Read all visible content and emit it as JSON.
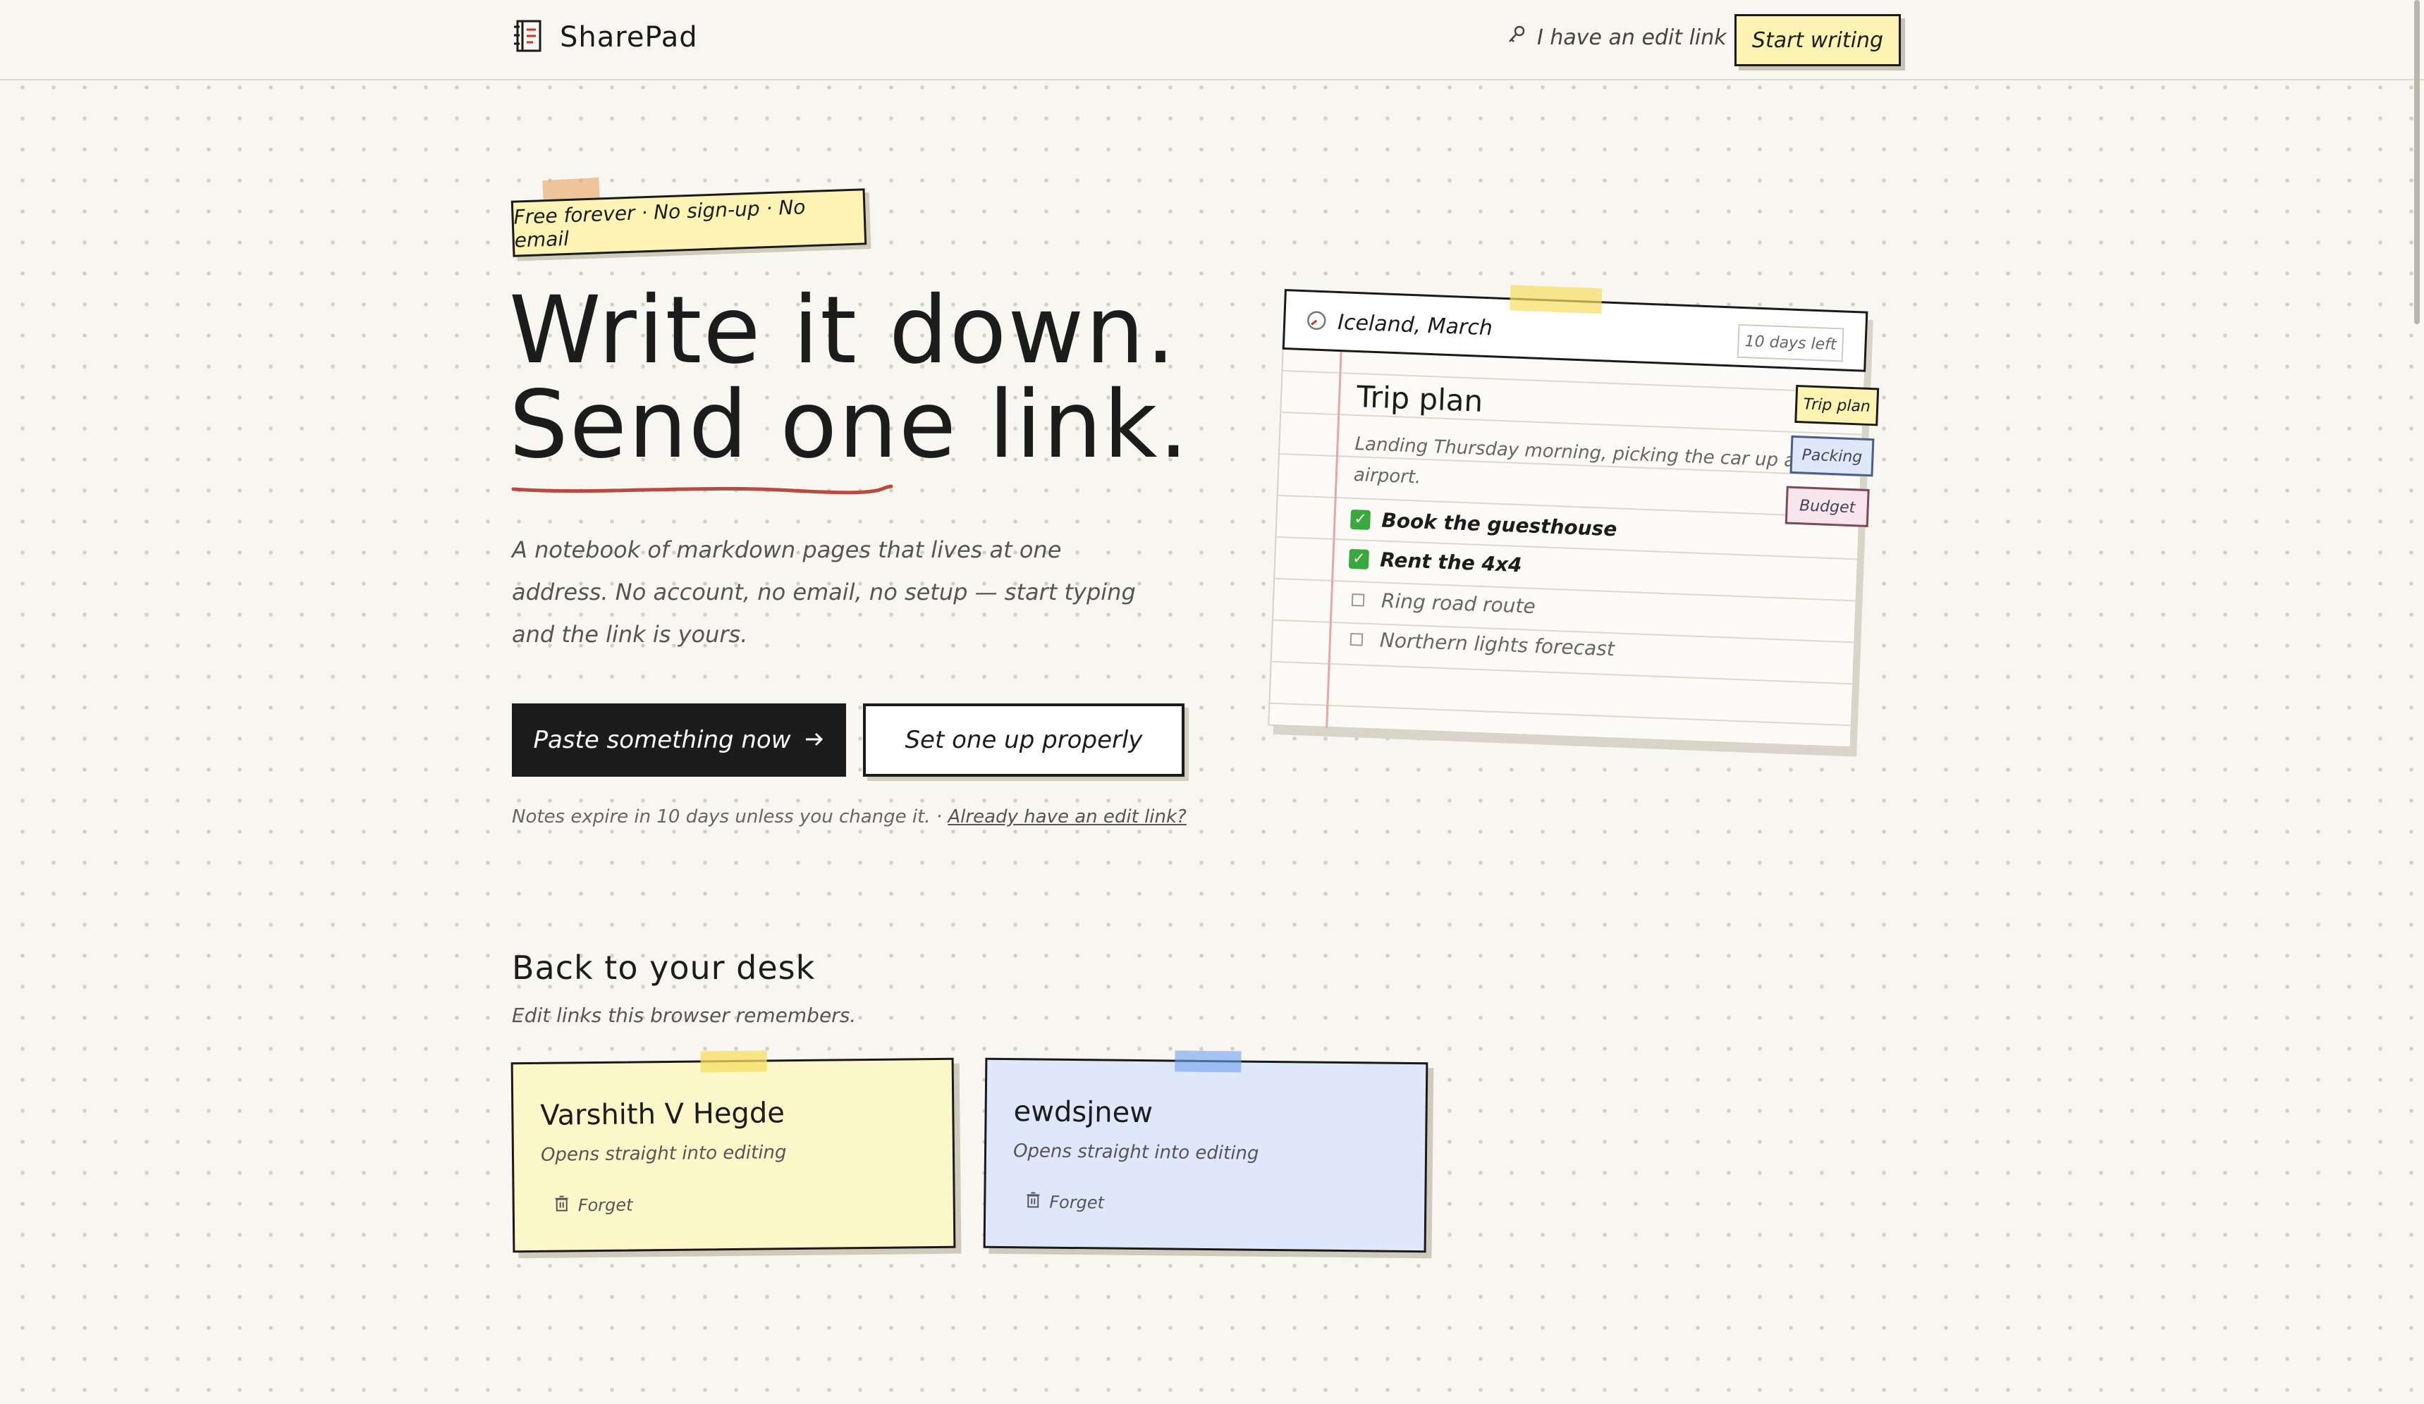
{
  "header": {
    "logo_name": "SharePad",
    "edit_link_label": "I have an edit link",
    "start_button_label": "Start writing"
  },
  "hero": {
    "badge": "Free forever · No sign-up · No email",
    "headline_line1": "Write it down.",
    "headline_line2": "Send one link.",
    "lede": "A notebook of markdown pages that lives at one address. No account, no email, no setup — start typing and the link is yours.",
    "primary_button": "Paste something now",
    "secondary_button": "Set one up properly",
    "expire_note": "Notes expire in 10 days unless you change it. ·",
    "expire_link": "Already have an edit link?"
  },
  "notebook": {
    "title": "Iceland, March",
    "days_left": "10 days left",
    "heading": "Trip plan",
    "body": "Landing Thursday morning, picking the car up at the airport.",
    "tasks": [
      {
        "label": "Book the guesthouse",
        "done": true
      },
      {
        "label": "Rent the 4x4",
        "done": true
      },
      {
        "label": "Ring road route",
        "done": false
      },
      {
        "label": "Northern lights forecast",
        "done": false
      }
    ],
    "tabs": [
      "Trip plan",
      "Packing",
      "Budget"
    ]
  },
  "desk": {
    "title": "Back to your desk",
    "subtitle": "Edit links this browser remembers.",
    "cards": [
      {
        "name": "Varshith V Hegde",
        "subtitle": "Opens straight into editing",
        "forget": "Forget",
        "color": "#fcf7c8"
      },
      {
        "name": "ewdsjnew",
        "subtitle": "Opens straight into editing",
        "forget": "Forget",
        "color": "#dfe8fa"
      }
    ]
  },
  "colors": {
    "background": "#f8f6f1",
    "accent_yellow": "#fcf3b2",
    "underline_red": "#b84b3f",
    "primary_button": "#1c1c1c",
    "check_green": "#39a83e"
  }
}
